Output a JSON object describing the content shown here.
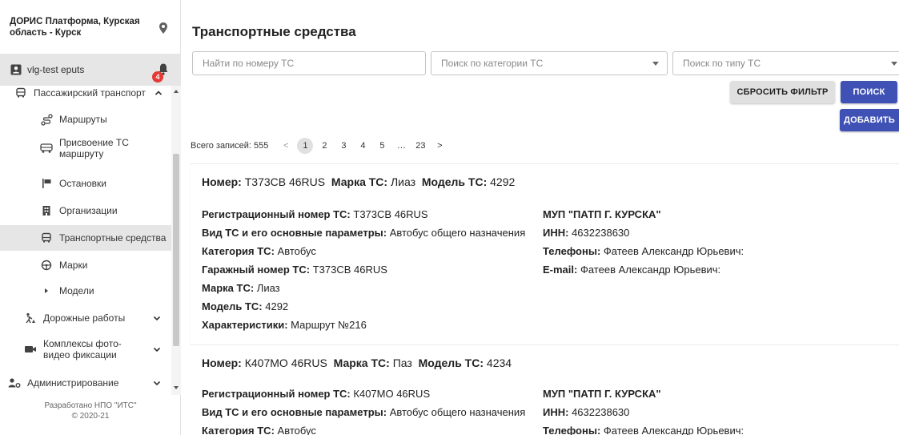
{
  "sidebar": {
    "org": "ДОРИС Платформа, Курская область - Курск",
    "user": "vlg-test eputs",
    "notifications": "4",
    "menu": [
      {
        "label": "Пассажирский транспорт",
        "icon": "bus-icon"
      },
      {
        "label": "Маршруты",
        "icon": "route-icon"
      },
      {
        "label": "Присвоение ТС маршруту",
        "icon": "bus-assign-icon"
      },
      {
        "label": "Остановки",
        "icon": "stop-icon"
      },
      {
        "label": "Организации",
        "icon": "building-icon"
      },
      {
        "label": "Транспортные средства",
        "icon": "vehicle-icon"
      },
      {
        "label": "Марки",
        "icon": "brand-icon"
      },
      {
        "label": "Модели",
        "icon": "play-icon"
      },
      {
        "label": "Дорожные работы",
        "icon": "roadworks-icon"
      },
      {
        "label": "Комплексы фото-видео фиксации",
        "icon": "camera-icon"
      },
      {
        "label": "Администрирование",
        "icon": "admin-icon"
      }
    ],
    "footer_line1": "Разработано НПО \"ИТС\"",
    "footer_line2": "© 2020-21"
  },
  "main": {
    "title": "Транспортные средства",
    "search_number_placeholder": "Найти по номеру ТС",
    "search_category_placeholder": "Поиск по категории ТС",
    "search_type_placeholder": "Поиск по типу ТС",
    "reset_label": "СБРОСИТЬ ФИЛЬТР",
    "search_label": "ПОИСК",
    "add_label": "ДОБАВИТЬ",
    "total": "Всего записей: 555",
    "pages": [
      "1",
      "2",
      "3",
      "4",
      "5",
      "…",
      "23"
    ],
    "prev": "<",
    "next": ">"
  },
  "labels": {
    "number": "Номер:",
    "brand": "Марка ТС:",
    "model": "Модель ТС:",
    "reg_number": "Регистрационный номер ТС:",
    "kind": "Вид ТС и его основные параметры:",
    "category": "Категория ТС:",
    "garage": "Гаражный номер ТС:",
    "characteristics": "Характеристики:",
    "inn": "ИНН:",
    "phones": "Телефоны:",
    "email": "E-mail:"
  },
  "vehicles": [
    {
      "number": "Т373СВ 46RUS",
      "brand": "Лиаз",
      "model": "4292",
      "reg_number": "Т373СВ 46RUS",
      "kind": "Автобус общего назначения",
      "category": "Автобус",
      "garage": "Т373СВ 46RUS",
      "characteristics": "Маршрут №216",
      "org": "МУП \"ПАТП Г. КУРСКА\"",
      "inn": "4632238630",
      "phones": "Фатеев Александр Юрьевич:",
      "email": "Фатеев Александр Юрьевич:"
    },
    {
      "number": "К407МО 46RUS",
      "brand": "Паз",
      "model": "4234",
      "reg_number": "К407МО 46RUS",
      "kind": "Автобус общего назначения",
      "category": "Автобус",
      "org": "МУП \"ПАТП Г. КУРСКА\"",
      "inn": "4632238630",
      "phones": "Фатеев Александр Юрьевич:"
    }
  ],
  "colors": {
    "primary": "#3f51b5",
    "badge": "#e53935",
    "active_bg": "#e6e6e6"
  }
}
